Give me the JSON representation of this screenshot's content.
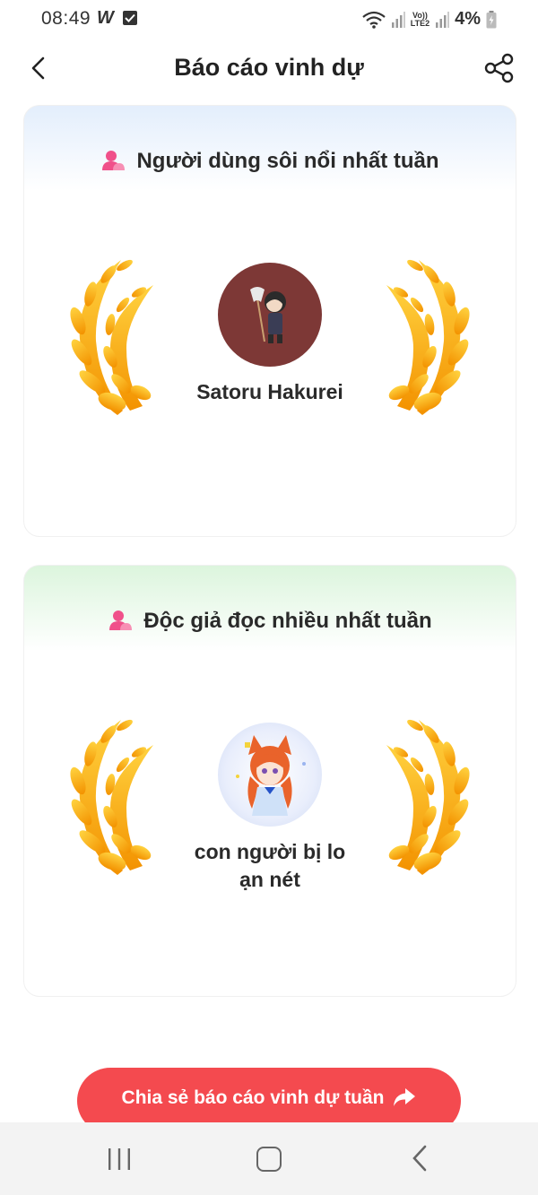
{
  "status_bar": {
    "time": "08:49",
    "app_letter": "W",
    "battery": "4%",
    "volte_top": "Vo))",
    "volte_bottom": "LTE2"
  },
  "header": {
    "title": "Báo cáo vinh dự"
  },
  "cards": [
    {
      "title": "Người dùng sôi nổi nhất tuần",
      "user_name": "Satoru Hakurei",
      "accent": "#e3eefc"
    },
    {
      "title": "Độc giả đọc nhiều nhất tuần",
      "user_name": "con người bị loạn nét",
      "accent": "#dcf5dd"
    }
  ],
  "share_button": {
    "label": "Chia sẻ báo cáo vinh dự tuần",
    "color": "#f44a4f"
  },
  "icons": [
    "back-arrow-icon",
    "share-icon",
    "user-icon",
    "laurel-icon",
    "share-arrow-icon"
  ]
}
